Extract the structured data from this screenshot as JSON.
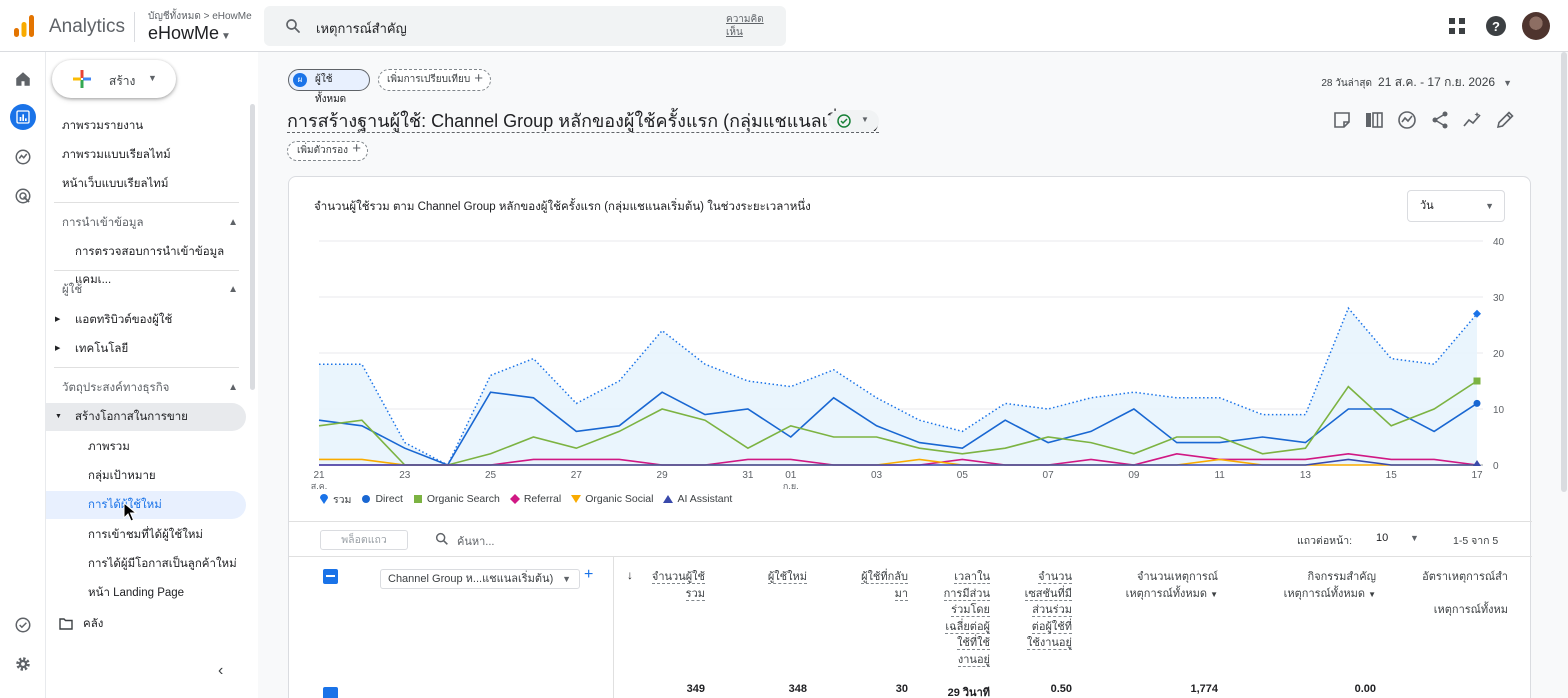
{
  "topbar": {
    "app_name": "Analytics",
    "breadcrumb": "บัญชีทั้งหมด > eHowMe",
    "property": "eHowMe",
    "search_value": "เหตุการณ์สำคัญ",
    "feedback": "ความคิดเห็น"
  },
  "sidebar": {
    "create_label": "สร้าง",
    "items": {
      "overview_reports": "ภาพรวมรายงาน",
      "realtime_overview": "ภาพรวมแบบเรียลไทม์",
      "realtime_pages": "หน้าเว็บแบบเรียลไทม์",
      "data_import_section": "การนำเข้าข้อมูล",
      "data_import_check": "การตรวจสอบการนำเข้าข้อมูลแคมเ...",
      "user_section": "ผู้ใช้",
      "user_attributes": "แอตทริบิวต์ของผู้ใช้",
      "tech": "เทคโนโลยี",
      "business_objectives": "วัตถุประสงค์ทางธุรกิจ",
      "generate_leads": "สร้างโอกาสในการขาย",
      "overview": "ภาพรวม",
      "audiences": "กลุ่มเป้าหมาย",
      "user_acquisition": "การได้ผู้ใช้ใหม่",
      "traffic_acquisition": "การเข้าชมที่ได้ผู้ใช้ใหม่",
      "lead_acquisition": "การได้ผู้มีโอกาสเป็นลูกค้าใหม่",
      "landing_page": "หน้า Landing Page",
      "library": "คลัง"
    }
  },
  "main": {
    "segment_chip": "ผู้ใช้ทั้งหมด",
    "segment_badge": "ผ",
    "compare_chip": "เพิ่มการเปรียบเทียบ",
    "date_prefix": "28 วันล่าสุด",
    "date_range": "21 ส.ค. - 17 ก.ย. 2026",
    "report_title": "การสร้างฐานผู้ใช้: Channel Group หลักของผู้ใช้ครั้งแรก (กลุ่มแชแนลเริ่มต้น)",
    "add_filter": "เพิ่มตัวกรอง",
    "chart_title": "จำนวนผู้ใช้รวม ตาม Channel Group หลักของผู้ใช้ครั้งแรก (กลุ่มแชแนลเริ่มต้น) ในช่วงระยะเวลาหนึ่ง",
    "period": "วัน"
  },
  "chart_data": {
    "type": "line",
    "title": "จำนวนผู้ใช้รวม ตาม Channel Group หลักของผู้ใช้ครั้งแรก (กลุ่มแชแนลเริ่มต้น) ในช่วงระยะเวลาหนึ่ง",
    "x": [
      "21",
      "22",
      "23",
      "24",
      "25",
      "26",
      "27",
      "28",
      "29",
      "30",
      "31",
      "01",
      "02",
      "03",
      "04",
      "05",
      "06",
      "07",
      "08",
      "09",
      "10",
      "11",
      "12",
      "13",
      "14",
      "15",
      "16",
      "17"
    ],
    "x_tick_labels": [
      "21",
      "23",
      "25",
      "27",
      "29",
      "31",
      "01",
      "03",
      "05",
      "07",
      "09",
      "11",
      "13",
      "15",
      "17"
    ],
    "x_month_labels": [
      {
        "at": "21",
        "label": "ส.ค."
      },
      {
        "at": "01",
        "label": "ก.ย."
      }
    ],
    "ylim": [
      0,
      40
    ],
    "y_ticks": [
      0,
      10,
      20,
      30,
      40
    ],
    "grid": true,
    "legend_position": "bottom-left",
    "series": [
      {
        "name": "รวม",
        "color": "#1a73e8",
        "style": "dotted-area",
        "values": [
          18,
          18,
          4,
          0,
          16,
          19,
          11,
          15,
          24,
          18,
          15,
          14,
          17,
          12,
          8,
          6,
          11,
          10,
          12,
          13,
          12,
          12,
          9,
          9,
          28,
          19,
          18,
          27
        ]
      },
      {
        "name": "Direct",
        "color": "#1967d2",
        "style": "line",
        "values": [
          8,
          7,
          3,
          0,
          13,
          12,
          6,
          7,
          13,
          9,
          10,
          5,
          12,
          7,
          4,
          3,
          8,
          4,
          6,
          10,
          4,
          4,
          5,
          4,
          10,
          10,
          6,
          11
        ]
      },
      {
        "name": "Organic Search",
        "color": "#7cb342",
        "style": "line",
        "values": [
          7,
          8,
          0,
          0,
          2,
          5,
          3,
          6,
          10,
          8,
          3,
          7,
          5,
          5,
          3,
          2,
          3,
          5,
          4,
          2,
          5,
          5,
          2,
          3,
          14,
          7,
          10,
          15
        ]
      },
      {
        "name": "Referral",
        "color": "#d01884",
        "style": "line",
        "values": [
          0,
          0,
          0,
          0,
          0,
          1,
          1,
          1,
          0,
          0,
          1,
          1,
          0,
          0,
          0,
          1,
          0,
          0,
          1,
          0,
          2,
          1,
          1,
          1,
          2,
          1,
          1,
          0
        ]
      },
      {
        "name": "Organic Social",
        "color": "#f9ab00",
        "style": "line",
        "values": [
          1,
          1,
          0,
          0,
          0,
          0,
          0,
          0,
          0,
          0,
          0,
          0,
          0,
          0,
          1,
          0,
          0,
          0,
          0,
          0,
          0,
          1,
          0,
          0,
          0,
          0,
          0,
          0
        ]
      },
      {
        "name": "AI Assistant",
        "color": "#3949ab",
        "style": "line",
        "values": [
          0,
          0,
          0,
          0,
          0,
          0,
          0,
          0,
          0,
          0,
          0,
          0,
          0,
          0,
          0,
          0,
          0,
          0,
          0,
          0,
          0,
          0,
          0,
          0,
          1,
          0,
          0,
          0
        ]
      }
    ]
  },
  "table": {
    "row_search": "พล็อตแถว",
    "search_placeholder": "ค้นหา...",
    "rows_per_page_label": "แถวต่อหน้า:",
    "rows_per_page": "10",
    "pager": "1-5 จาก 5",
    "dimension": "Channel Group ห...แชแนลเริ่มต้น)",
    "columns": [
      {
        "l1": "จำนวนผู้ใช้",
        "l2": "รวม"
      },
      {
        "l1": "ผู้ใช้ใหม่",
        "l2": ""
      },
      {
        "l1": "ผู้ใช้ที่กลับ",
        "l2": "มา"
      },
      {
        "l1": "เวลาใน",
        "l2": "การมีส่วน",
        "l3": "ร่วมโดย",
        "l4": "เฉลี่ยต่อผู้",
        "l5": "ใช้ที่ใช้",
        "l6": "งานอยู่"
      },
      {
        "l1": "จำนวน",
        "l2": "เซสชันที่มี",
        "l3": "ส่วนร่วม",
        "l4": "ต่อผู้ใช้ที่",
        "l5": "ใช้งานอยู่"
      },
      {
        "l1": "จำนวนเหตุการณ์",
        "l2": "เหตุการณ์ทั้งหมด"
      },
      {
        "l1": "กิจกรรมสำคัญ",
        "l2": "เหตุการณ์ทั้งหมด"
      },
      {
        "l1": "อัตราเหตุการณ์สำ",
        "l2": "เหตุการณ์ทั้งหม"
      }
    ],
    "totals": [
      "349",
      "348",
      "30",
      "29 วินาที",
      "0.50",
      "1,774",
      "0.00"
    ]
  }
}
